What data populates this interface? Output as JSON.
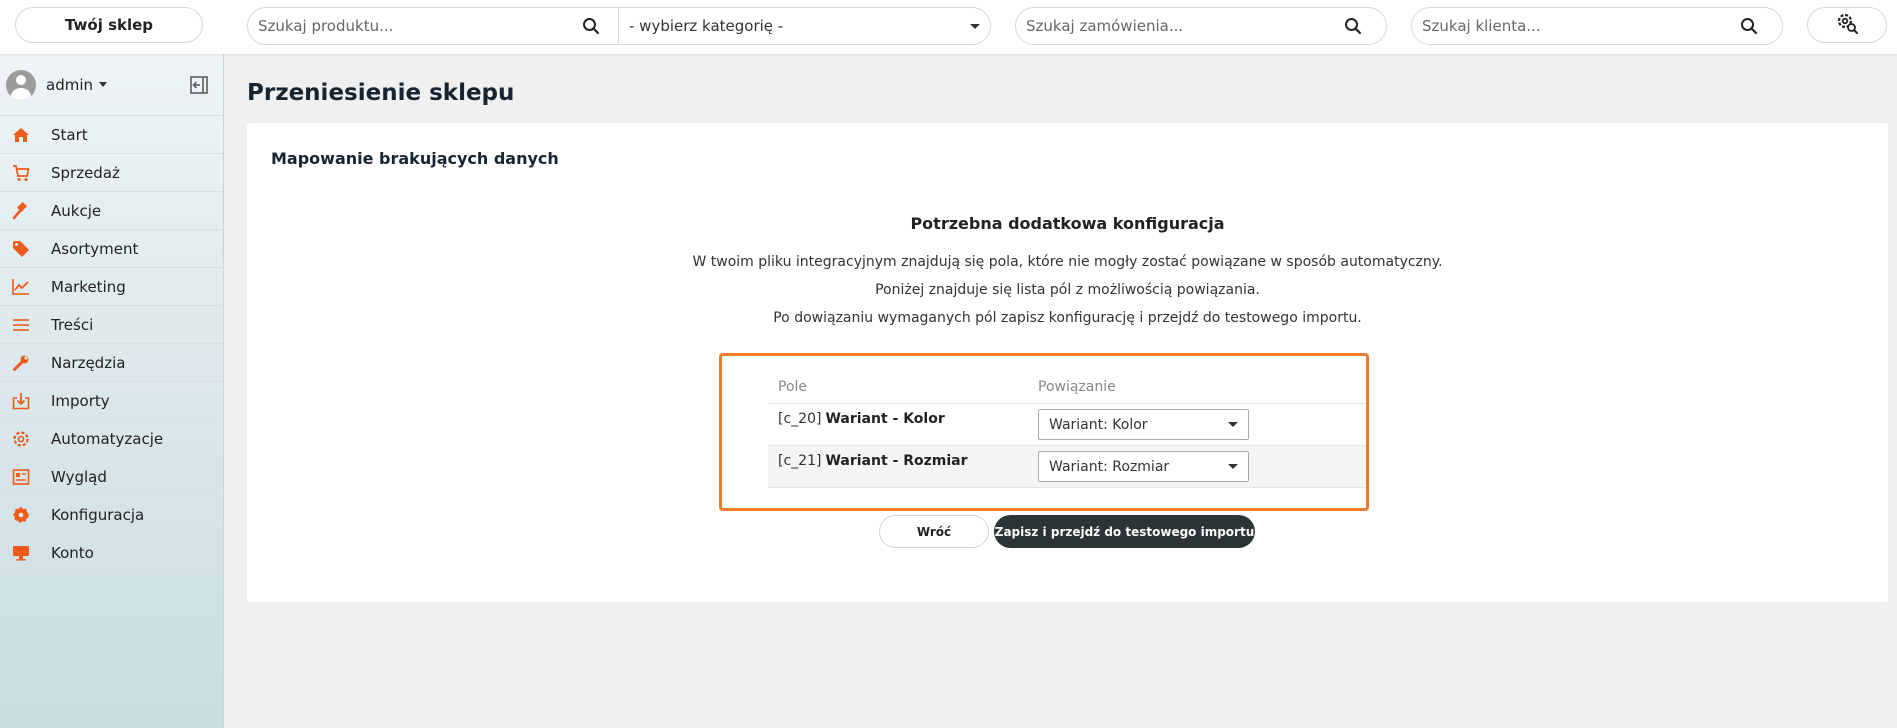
{
  "header": {
    "shop_button": "Twój sklep",
    "product_search_placeholder": "Szukaj produktu...",
    "category_select": "- wybierz kategorię -",
    "order_search_placeholder": "Szukaj zamówienia...",
    "client_search_placeholder": "Szukaj klienta..."
  },
  "sidebar": {
    "user": "admin",
    "items": [
      {
        "label": "Start",
        "icon": "home-icon"
      },
      {
        "label": "Sprzedaż",
        "icon": "cart-icon"
      },
      {
        "label": "Aukcje",
        "icon": "gavel-icon"
      },
      {
        "label": "Asortyment",
        "icon": "tag-icon"
      },
      {
        "label": "Marketing",
        "icon": "chart-line-icon"
      },
      {
        "label": "Treści",
        "icon": "lines-icon"
      },
      {
        "label": "Narzędzia",
        "icon": "wrench-icon"
      },
      {
        "label": "Importy",
        "icon": "import-icon"
      },
      {
        "label": "Automatyzacje",
        "icon": "automation-gear-icon"
      },
      {
        "label": "Wygląd",
        "icon": "layout-icon"
      },
      {
        "label": "Konfiguracja",
        "icon": "gear-icon"
      },
      {
        "label": "Konto",
        "icon": "monitor-icon"
      }
    ],
    "accent_color": "#f05a1a"
  },
  "main": {
    "page_title": "Przeniesienie sklepu",
    "card_title": "Mapowanie brakujących danych",
    "config_title": "Potrzebna dodatkowa konfiguracja",
    "info_lines": [
      "W twoim pliku integracyjnym znajdują się pola, które nie mogły zostać powiązane w sposób automatyczny.",
      "Poniżej znajduje się lista pól z możliwością powiązania.",
      "Po dowiązaniu wymaganych pól zapisz konfigurację i przejdź do testowego importu."
    ],
    "table": {
      "headers": [
        "Pole",
        "Powiązanie"
      ],
      "rows": [
        {
          "code": "[c_20]",
          "name": "Wariant - Kolor",
          "value": "Wariant: Kolor"
        },
        {
          "code": "[c_21]",
          "name": "Wariant - Rozmiar",
          "value": "Wariant: Rozmiar"
        }
      ]
    },
    "back_button": "Wróć",
    "save_button": "Zapisz i przejdź do testowego importu",
    "highlight_color": "#ee7a2f"
  }
}
